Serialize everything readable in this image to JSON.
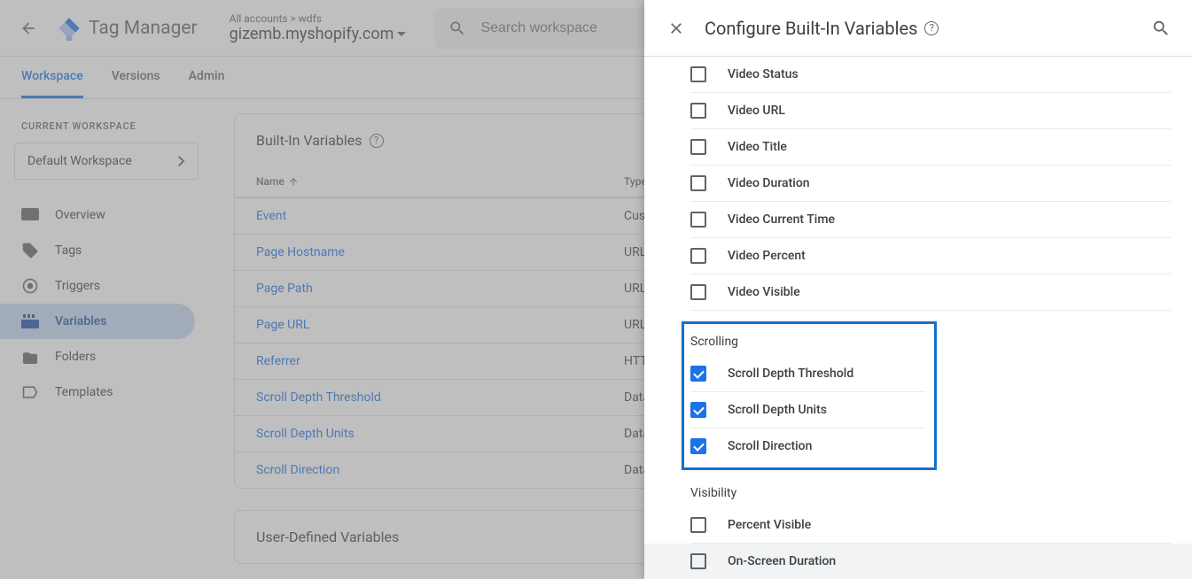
{
  "header": {
    "product": "Tag Manager",
    "breadcrumb": "All accounts > wdfs",
    "container": "gizemb.myshopify.com",
    "search_placeholder": "Search workspace"
  },
  "tabs": {
    "workspace": "Workspace",
    "versions": "Versions",
    "admin": "Admin"
  },
  "sidebar": {
    "label": "CURRENT WORKSPACE",
    "workspace": "Default Workspace",
    "items": [
      {
        "label": "Overview"
      },
      {
        "label": "Tags"
      },
      {
        "label": "Triggers"
      },
      {
        "label": "Variables"
      },
      {
        "label": "Folders"
      },
      {
        "label": "Templates"
      }
    ]
  },
  "card1": {
    "title": "Built-In Variables",
    "col_name": "Name",
    "col_type": "Type",
    "rows": [
      {
        "name": "Event",
        "type": "Custom"
      },
      {
        "name": "Page Hostname",
        "type": "URL"
      },
      {
        "name": "Page Path",
        "type": "URL"
      },
      {
        "name": "Page URL",
        "type": "URL"
      },
      {
        "name": "Referrer",
        "type": "HTTP Referrer"
      },
      {
        "name": "Scroll Depth Threshold",
        "type": "Data Layer"
      },
      {
        "name": "Scroll Depth Units",
        "type": "Data Layer"
      },
      {
        "name": "Scroll Direction",
        "type": "Data Layer"
      }
    ]
  },
  "card2": {
    "title": "User-Defined Variables"
  },
  "drawer": {
    "title": "Configure Built-In Variables",
    "video_items": [
      "Video Status",
      "Video URL",
      "Video Title",
      "Video Duration",
      "Video Current Time",
      "Video Percent",
      "Video Visible"
    ],
    "scrolling_title": "Scrolling",
    "scrolling_items": [
      "Scroll Depth Threshold",
      "Scroll Depth Units",
      "Scroll Direction"
    ],
    "visibility_title": "Visibility",
    "visibility_items": [
      "Percent Visible",
      "On-Screen Duration"
    ]
  }
}
